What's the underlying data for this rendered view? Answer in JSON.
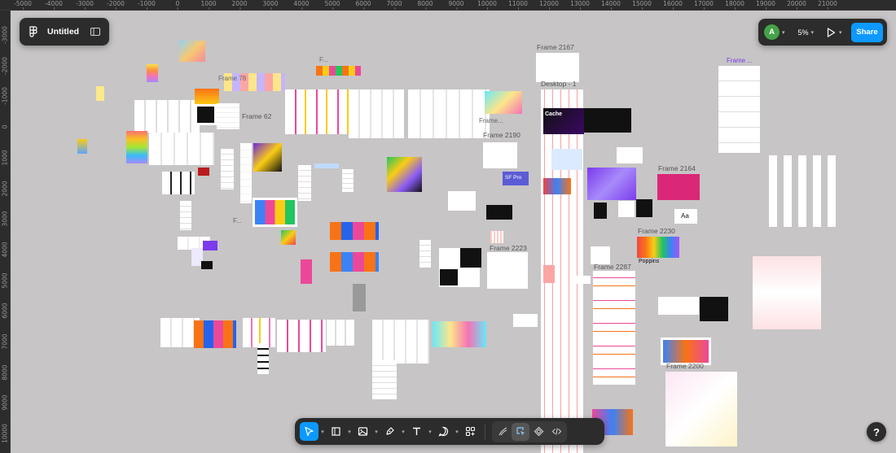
{
  "app": {
    "file_name": "Untitled",
    "zoom": "5%",
    "share_label": "Share",
    "avatar_initial": "A",
    "help_label": "?",
    "accent_color": "#0d99ff",
    "avatar_color": "#46a248"
  },
  "ruler_top": [
    "-5000",
    "-4000",
    "-3000",
    "-2000",
    "-1000",
    "0",
    "1000",
    "2000",
    "3000",
    "4000",
    "5000",
    "6000",
    "7000",
    "8000",
    "9000",
    "10000",
    "11000",
    "12000",
    "13000",
    "14000",
    "15000",
    "16000",
    "17000",
    "18000",
    "19000",
    "20000",
    "21000"
  ],
  "ruler_left": [
    "-3000",
    "-2000",
    "-1000",
    "0",
    "1000",
    "2000",
    "3000",
    "4000",
    "5000",
    "6000",
    "7000",
    "8000",
    "9000",
    "10000"
  ],
  "frame_labels": {
    "frame_62": "Frame 62",
    "frame_2167": "Frame 2167",
    "desktop_1": "Desktop - 1",
    "frame_2190": "Frame 2190",
    "frame_2164": "Frame 2164",
    "frame_2230": "Frame 2230",
    "frame_2223": "Frame 2223",
    "frame_2287": "Frame 2287",
    "frame_2200": "Frame 2200",
    "frame_ellipsis": "Frame ...",
    "frame_78": "Frame 78",
    "f_short": "F...",
    "frame_short": "Frame...",
    "f_dots": "F..."
  },
  "canvas_text": {
    "cache": "Cache",
    "sf_pro": "SF Pro",
    "aa": "Aa",
    "poppins": "Poppins"
  },
  "toolbar": {
    "tools": [
      "move-tool",
      "frame-tool",
      "image-tool",
      "pen-tool",
      "text-tool",
      "comment-tool",
      "actions-tool"
    ],
    "modes": [
      "draw-mode",
      "design-mode",
      "dev-components-mode",
      "dev-mode"
    ]
  }
}
